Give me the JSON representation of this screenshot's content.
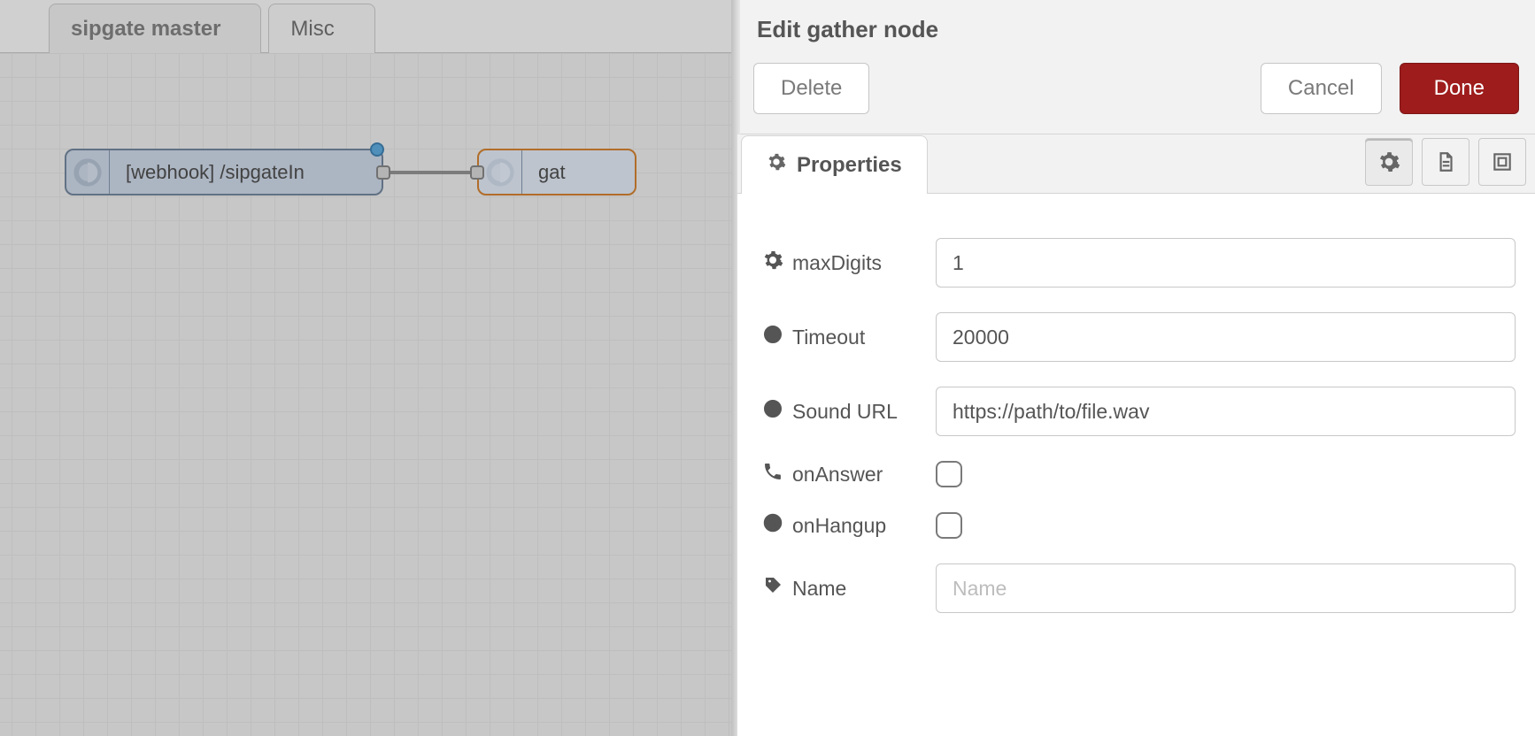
{
  "workspace": {
    "tabs": [
      {
        "label": "sipgate master",
        "active": true
      },
      {
        "label": "Misc",
        "active": false
      }
    ],
    "nodes": {
      "webhook": {
        "label": "[webhook] /sipgateIn"
      },
      "gather": {
        "label": "gat"
      }
    }
  },
  "panel": {
    "title": "Edit gather node",
    "buttons": {
      "delete": "Delete",
      "cancel": "Cancel",
      "done": "Done"
    },
    "tab_label": "Properties",
    "form": {
      "maxDigits": {
        "label": "maxDigits",
        "value": "1"
      },
      "timeout": {
        "label": "Timeout",
        "value": "20000"
      },
      "soundUrl": {
        "label": "Sound URL",
        "value": "https://path/to/file.wav"
      },
      "onAnswer": {
        "label": "onAnswer",
        "checked": false
      },
      "onHangup": {
        "label": "onHangup",
        "checked": false
      },
      "name": {
        "label": "Name",
        "value": "",
        "placeholder": "Name"
      }
    }
  }
}
